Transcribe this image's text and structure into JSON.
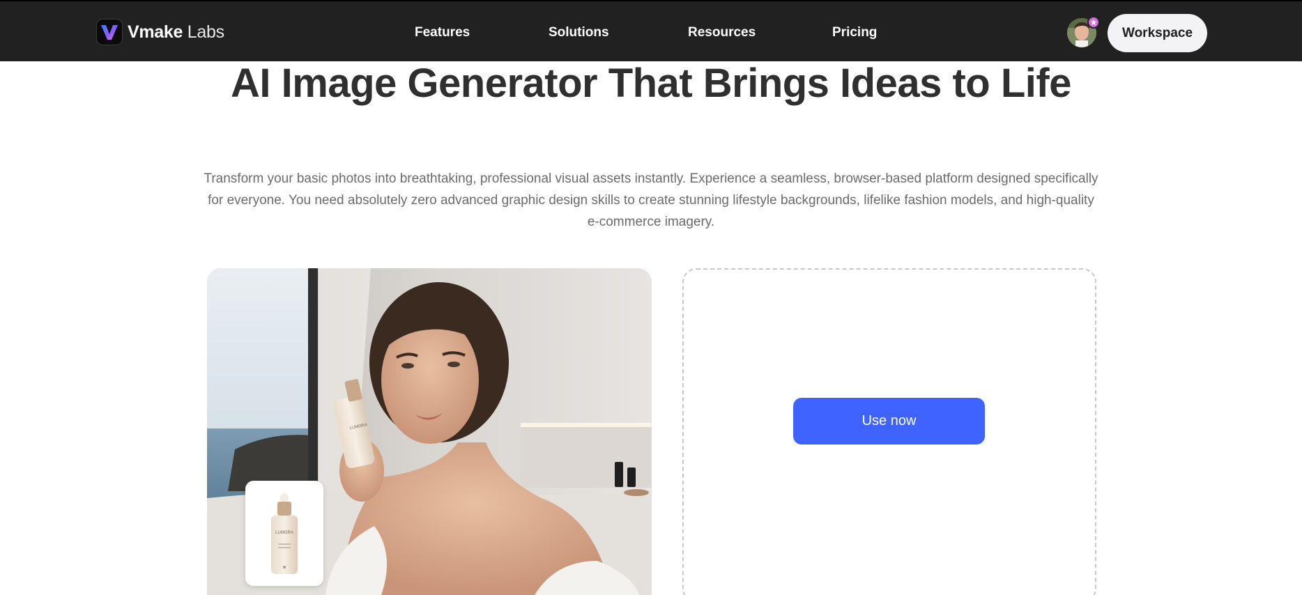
{
  "header": {
    "logo": {
      "brand": "Vmake",
      "suffix": " Labs"
    },
    "nav": [
      {
        "label": "Features"
      },
      {
        "label": "Solutions"
      },
      {
        "label": "Resources"
      },
      {
        "label": "Pricing"
      }
    ],
    "workspace_label": "Workspace",
    "avatar_icon": "user-avatar",
    "badge_icon": "star-badge-icon"
  },
  "hero": {
    "title": "AI Image Generator That Brings Ideas to Life",
    "description": "Transform your basic photos into breathtaking, professional visual assets instantly. Experience a seamless, browser-based platform designed specifically for everyone. You need absolutely zero advanced graphic design skills to create stunning lifestyle backgrounds, lifelike fashion models, and high-quality e-commerce imagery."
  },
  "preview": {
    "product_label": "LUMORA"
  },
  "cta": {
    "use_now_label": "Use now"
  },
  "colors": {
    "nav_bg": "#212121",
    "accent": "#3f63ff",
    "title": "#2f2f2f",
    "body_text": "#6b6b6b"
  }
}
